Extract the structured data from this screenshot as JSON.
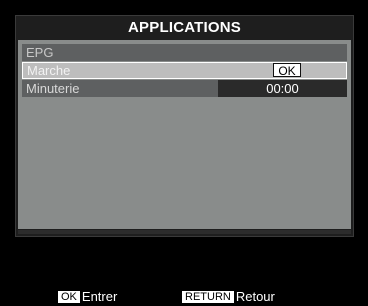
{
  "window": {
    "title": "APPLICATIONS"
  },
  "menu": {
    "items": [
      {
        "label": "EPG",
        "value": ""
      },
      {
        "label": "Marche",
        "value": "OK"
      },
      {
        "label": "Minuterie",
        "value": "00:00"
      }
    ],
    "selected_index": 1
  },
  "footer": {
    "enter_key": "OK",
    "enter_label": "Entrer",
    "return_key": "RETURN",
    "return_label": "Retour"
  },
  "colors": {
    "background": "#000000",
    "panel": "#898c8b",
    "row": "#5e6061",
    "selected_row": "#bdbdbd"
  }
}
